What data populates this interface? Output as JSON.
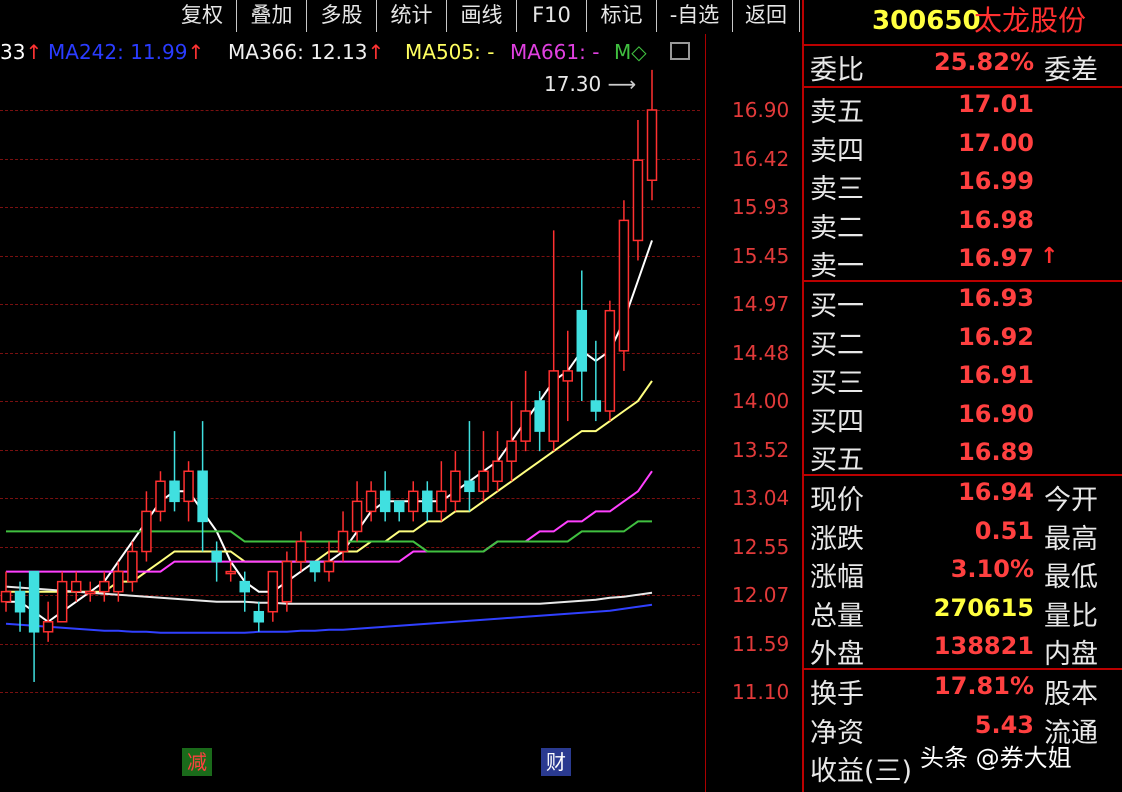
{
  "toolbar": {
    "buttons": [
      "复权",
      "叠加",
      "多股",
      "统计",
      "画线",
      "F10",
      "标记",
      "-自选",
      "返回"
    ]
  },
  "ma_bar": {
    "prefix": "33",
    "ma242": "MA242: 11.99",
    "ma366": "MA366: 12.13",
    "ma505": "MA505: -",
    "ma661": "MA661: -",
    "m": "M◇"
  },
  "chart": {
    "high_label": "17.30",
    "y_ticks": [
      "16.90",
      "16.42",
      "15.93",
      "15.45",
      "14.97",
      "14.48",
      "14.00",
      "13.52",
      "13.04",
      "12.55",
      "12.07",
      "11.59",
      "11.10"
    ],
    "tags": [
      "减",
      "财"
    ]
  },
  "quote": {
    "code": "300650",
    "name": "太龙股份",
    "weibi_label": "委比",
    "weibi_value": "25.82%",
    "weicha_label": "委差",
    "sells": [
      {
        "label": "卖五",
        "price": "17.01"
      },
      {
        "label": "卖四",
        "price": "17.00"
      },
      {
        "label": "卖三",
        "price": "16.99"
      },
      {
        "label": "卖二",
        "price": "16.98"
      },
      {
        "label": "卖一",
        "price": "16.97"
      }
    ],
    "buys": [
      {
        "label": "买一",
        "price": "16.93"
      },
      {
        "label": "买二",
        "price": "16.92"
      },
      {
        "label": "买三",
        "price": "16.91"
      },
      {
        "label": "买四",
        "price": "16.90"
      },
      {
        "label": "买五",
        "price": "16.89"
      }
    ],
    "stats": [
      {
        "label": "现价",
        "value": "16.94",
        "label2": "今开"
      },
      {
        "label": "涨跌",
        "value": "0.51",
        "label2": "最高"
      },
      {
        "label": "涨幅",
        "value": "3.10%",
        "label2": "最低"
      },
      {
        "label": "总量",
        "value": "270615",
        "label2": "量比"
      },
      {
        "label": "外盘",
        "value": "138821",
        "label2": "内盘"
      }
    ],
    "stats2": [
      {
        "label": "换手",
        "value": "17.81%",
        "label2": "股本"
      },
      {
        "label": "净资",
        "value": "5.43",
        "label2": "流通"
      },
      {
        "label": "收益(三)",
        "value": "",
        "label2": ""
      }
    ]
  },
  "watermark": "头条 @券大姐",
  "chart_data": {
    "type": "candlestick",
    "y_ticks": [
      16.9,
      16.42,
      15.93,
      15.45,
      14.97,
      14.48,
      14.0,
      13.52,
      13.04,
      12.55,
      12.07,
      11.59,
      11.1
    ],
    "ylim": [
      10.9,
      17.4
    ],
    "last_high": 17.3,
    "candles": [
      {
        "o": 12.0,
        "c": 12.1,
        "h": 12.3,
        "l": 11.9
      },
      {
        "o": 12.1,
        "c": 11.9,
        "h": 12.2,
        "l": 11.7
      },
      {
        "o": 12.3,
        "c": 11.7,
        "h": 12.3,
        "l": 11.2
      },
      {
        "o": 11.7,
        "c": 11.8,
        "h": 12.0,
        "l": 11.6
      },
      {
        "o": 11.8,
        "c": 12.2,
        "h": 12.3,
        "l": 11.8
      },
      {
        "o": 12.1,
        "c": 12.2,
        "h": 12.3,
        "l": 12.0
      },
      {
        "o": 12.1,
        "c": 12.1,
        "h": 12.2,
        "l": 12.0
      },
      {
        "o": 12.1,
        "c": 12.2,
        "h": 12.3,
        "l": 12.0
      },
      {
        "o": 12.1,
        "c": 12.3,
        "h": 12.4,
        "l": 12.0
      },
      {
        "o": 12.2,
        "c": 12.5,
        "h": 12.6,
        "l": 12.1
      },
      {
        "o": 12.5,
        "c": 12.9,
        "h": 13.1,
        "l": 12.4
      },
      {
        "o": 12.9,
        "c": 13.2,
        "h": 13.3,
        "l": 12.8
      },
      {
        "o": 13.2,
        "c": 13.0,
        "h": 13.7,
        "l": 12.9
      },
      {
        "o": 13.0,
        "c": 13.3,
        "h": 13.4,
        "l": 12.8
      },
      {
        "o": 13.3,
        "c": 12.8,
        "h": 13.8,
        "l": 12.5
      },
      {
        "o": 12.5,
        "c": 12.4,
        "h": 12.6,
        "l": 12.2
      },
      {
        "o": 12.3,
        "c": 12.3,
        "h": 12.4,
        "l": 12.2
      },
      {
        "o": 12.2,
        "c": 12.1,
        "h": 12.3,
        "l": 11.9
      },
      {
        "o": 11.9,
        "c": 11.8,
        "h": 12.0,
        "l": 11.7
      },
      {
        "o": 11.9,
        "c": 12.3,
        "h": 12.3,
        "l": 11.8
      },
      {
        "o": 12.0,
        "c": 12.4,
        "h": 12.5,
        "l": 11.9
      },
      {
        "o": 12.4,
        "c": 12.6,
        "h": 12.7,
        "l": 12.3
      },
      {
        "o": 12.4,
        "c": 12.3,
        "h": 12.4,
        "l": 12.2
      },
      {
        "o": 12.3,
        "c": 12.4,
        "h": 12.6,
        "l": 12.2
      },
      {
        "o": 12.5,
        "c": 12.7,
        "h": 12.9,
        "l": 12.4
      },
      {
        "o": 12.7,
        "c": 13.0,
        "h": 13.2,
        "l": 12.6
      },
      {
        "o": 12.9,
        "c": 13.1,
        "h": 13.2,
        "l": 12.8
      },
      {
        "o": 13.1,
        "c": 12.9,
        "h": 13.3,
        "l": 12.8
      },
      {
        "o": 13.0,
        "c": 12.9,
        "h": 13.0,
        "l": 12.8
      },
      {
        "o": 12.9,
        "c": 13.1,
        "h": 13.2,
        "l": 12.8
      },
      {
        "o": 13.1,
        "c": 12.9,
        "h": 13.2,
        "l": 12.8
      },
      {
        "o": 12.9,
        "c": 13.1,
        "h": 13.4,
        "l": 12.8
      },
      {
        "o": 13.0,
        "c": 13.3,
        "h": 13.5,
        "l": 12.9
      },
      {
        "o": 13.2,
        "c": 13.1,
        "h": 13.8,
        "l": 12.9
      },
      {
        "o": 13.1,
        "c": 13.3,
        "h": 13.7,
        "l": 13.0
      },
      {
        "o": 13.2,
        "c": 13.4,
        "h": 13.7,
        "l": 13.1
      },
      {
        "o": 13.4,
        "c": 13.6,
        "h": 14.0,
        "l": 13.2
      },
      {
        "o": 13.6,
        "c": 13.9,
        "h": 14.3,
        "l": 13.5
      },
      {
        "o": 14.0,
        "c": 13.7,
        "h": 14.1,
        "l": 13.5
      },
      {
        "o": 13.6,
        "c": 14.3,
        "h": 15.7,
        "l": 13.5
      },
      {
        "o": 14.2,
        "c": 14.3,
        "h": 14.7,
        "l": 13.8
      },
      {
        "o": 14.9,
        "c": 14.3,
        "h": 15.3,
        "l": 14.0
      },
      {
        "o": 14.0,
        "c": 13.9,
        "h": 14.6,
        "l": 13.8
      },
      {
        "o": 13.9,
        "c": 14.9,
        "h": 15.0,
        "l": 13.8
      },
      {
        "o": 14.5,
        "c": 15.8,
        "h": 16.0,
        "l": 14.3
      },
      {
        "o": 15.6,
        "c": 16.4,
        "h": 16.8,
        "l": 15.4
      },
      {
        "o": 16.2,
        "c": 16.9,
        "h": 17.3,
        "l": 16.0
      }
    ],
    "ma_lines": [
      {
        "color": "#ffffff",
        "values": [
          12.0,
          12.0,
          11.9,
          11.8,
          11.9,
          12.0,
          12.1,
          12.2,
          12.4,
          12.6,
          12.8,
          13.0,
          13.1,
          13.1,
          12.9,
          12.7,
          12.4,
          12.2,
          12.1,
          12.1,
          12.2,
          12.3,
          12.4,
          12.4,
          12.5,
          12.7,
          12.9,
          13.0,
          13.0,
          13.0,
          13.0,
          13.0,
          13.1,
          13.2,
          13.3,
          13.4,
          13.6,
          13.8,
          14.0,
          14.2,
          14.3,
          14.5,
          14.4,
          14.5,
          14.8,
          15.2,
          15.6
        ]
      },
      {
        "color": "#ffff80",
        "values": [
          12.1,
          12.1,
          12.1,
          12.1,
          12.1,
          12.1,
          12.1,
          12.1,
          12.2,
          12.2,
          12.3,
          12.4,
          12.5,
          12.5,
          12.5,
          12.5,
          12.5,
          12.4,
          12.4,
          12.4,
          12.4,
          12.4,
          12.4,
          12.5,
          12.5,
          12.5,
          12.6,
          12.6,
          12.7,
          12.7,
          12.8,
          12.8,
          12.9,
          12.9,
          13.0,
          13.1,
          13.2,
          13.3,
          13.4,
          13.5,
          13.6,
          13.7,
          13.7,
          13.8,
          13.9,
          14.0,
          14.2
        ]
      },
      {
        "color": "#ff40ff",
        "values": [
          12.3,
          12.3,
          12.3,
          12.3,
          12.3,
          12.3,
          12.3,
          12.3,
          12.3,
          12.3,
          12.3,
          12.3,
          12.4,
          12.4,
          12.4,
          12.4,
          12.4,
          12.4,
          12.4,
          12.4,
          12.4,
          12.4,
          12.4,
          12.4,
          12.4,
          12.4,
          12.4,
          12.4,
          12.4,
          12.5,
          12.5,
          12.5,
          12.5,
          12.5,
          12.5,
          12.6,
          12.6,
          12.6,
          12.7,
          12.7,
          12.8,
          12.8,
          12.9,
          12.9,
          13.0,
          13.1,
          13.3
        ]
      },
      {
        "color": "#40c040",
        "values": [
          12.7,
          12.7,
          12.7,
          12.7,
          12.7,
          12.7,
          12.7,
          12.7,
          12.7,
          12.7,
          12.7,
          12.7,
          12.7,
          12.7,
          12.7,
          12.7,
          12.7,
          12.6,
          12.6,
          12.6,
          12.6,
          12.6,
          12.6,
          12.6,
          12.6,
          12.6,
          12.6,
          12.6,
          12.6,
          12.6,
          12.5,
          12.5,
          12.5,
          12.5,
          12.5,
          12.6,
          12.6,
          12.6,
          12.6,
          12.6,
          12.6,
          12.7,
          12.7,
          12.7,
          12.7,
          12.8,
          12.8
        ]
      },
      {
        "color": "#e8e8e8",
        "values": [
          12.15,
          12.14,
          12.13,
          12.12,
          12.11,
          12.1,
          12.09,
          12.08,
          12.07,
          12.06,
          12.05,
          12.04,
          12.03,
          12.02,
          12.01,
          12.0,
          12.0,
          12.0,
          11.99,
          11.99,
          11.98,
          11.98,
          11.98,
          11.98,
          11.98,
          11.98,
          11.98,
          11.98,
          11.98,
          11.98,
          11.98,
          11.98,
          11.98,
          11.98,
          11.98,
          11.98,
          11.98,
          11.98,
          11.98,
          11.99,
          12.0,
          12.01,
          12.02,
          12.04,
          12.05,
          12.07,
          12.09
        ]
      },
      {
        "color": "#3040ff",
        "values": [
          11.78,
          11.77,
          11.76,
          11.75,
          11.74,
          11.73,
          11.72,
          11.71,
          11.71,
          11.7,
          11.7,
          11.69,
          11.69,
          11.69,
          11.69,
          11.69,
          11.69,
          11.69,
          11.7,
          11.7,
          11.7,
          11.71,
          11.71,
          11.72,
          11.72,
          11.73,
          11.74,
          11.75,
          11.76,
          11.77,
          11.78,
          11.79,
          11.8,
          11.81,
          11.82,
          11.83,
          11.84,
          11.85,
          11.86,
          11.87,
          11.88,
          11.89,
          11.9,
          11.91,
          11.93,
          11.95,
          11.97
        ]
      }
    ]
  }
}
